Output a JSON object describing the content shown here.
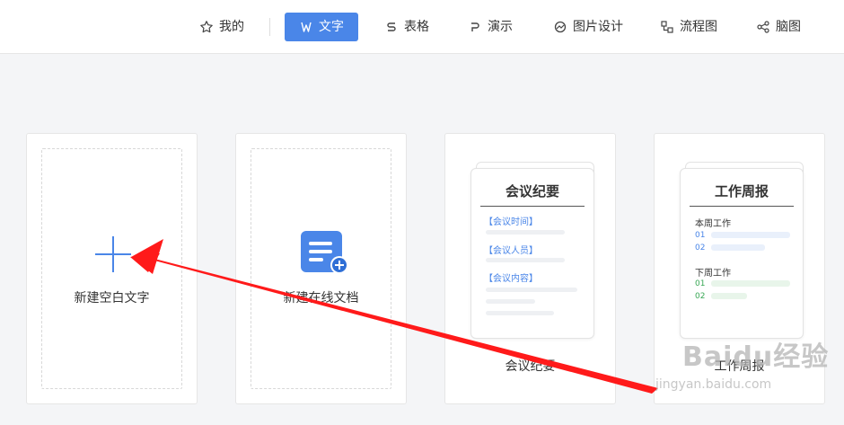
{
  "nav": {
    "tabs": [
      {
        "label": "我的",
        "icon": "star-icon"
      },
      {
        "label": "文字",
        "icon": "w-icon",
        "active": true
      },
      {
        "label": "表格",
        "icon": "s-icon"
      },
      {
        "label": "演示",
        "icon": "p-icon"
      },
      {
        "label": "图片设计",
        "icon": "image-design-icon"
      },
      {
        "label": "流程图",
        "icon": "flowchart-icon"
      },
      {
        "label": "脑图",
        "icon": "mindmap-icon"
      }
    ]
  },
  "cards": {
    "blank": {
      "label": "新建空白文字"
    },
    "online": {
      "label": "新建在线文档"
    },
    "meeting": {
      "label": "会议纪要",
      "preview_title": "会议纪要",
      "fields": [
        "【会议时间】",
        "【会议人员】",
        "【会议内容】"
      ]
    },
    "weekly": {
      "label": "工作周报",
      "preview_title": "工作周报",
      "this_week": "本周工作",
      "next_week": "下周工作",
      "nums": [
        "01",
        "02",
        "01",
        "02"
      ]
    }
  },
  "watermark": {
    "brand": "Baidu经验",
    "url": "jingyan.baidu.com"
  },
  "colors": {
    "accent": "#4a86e8",
    "arrow": "#ff1a1a"
  }
}
